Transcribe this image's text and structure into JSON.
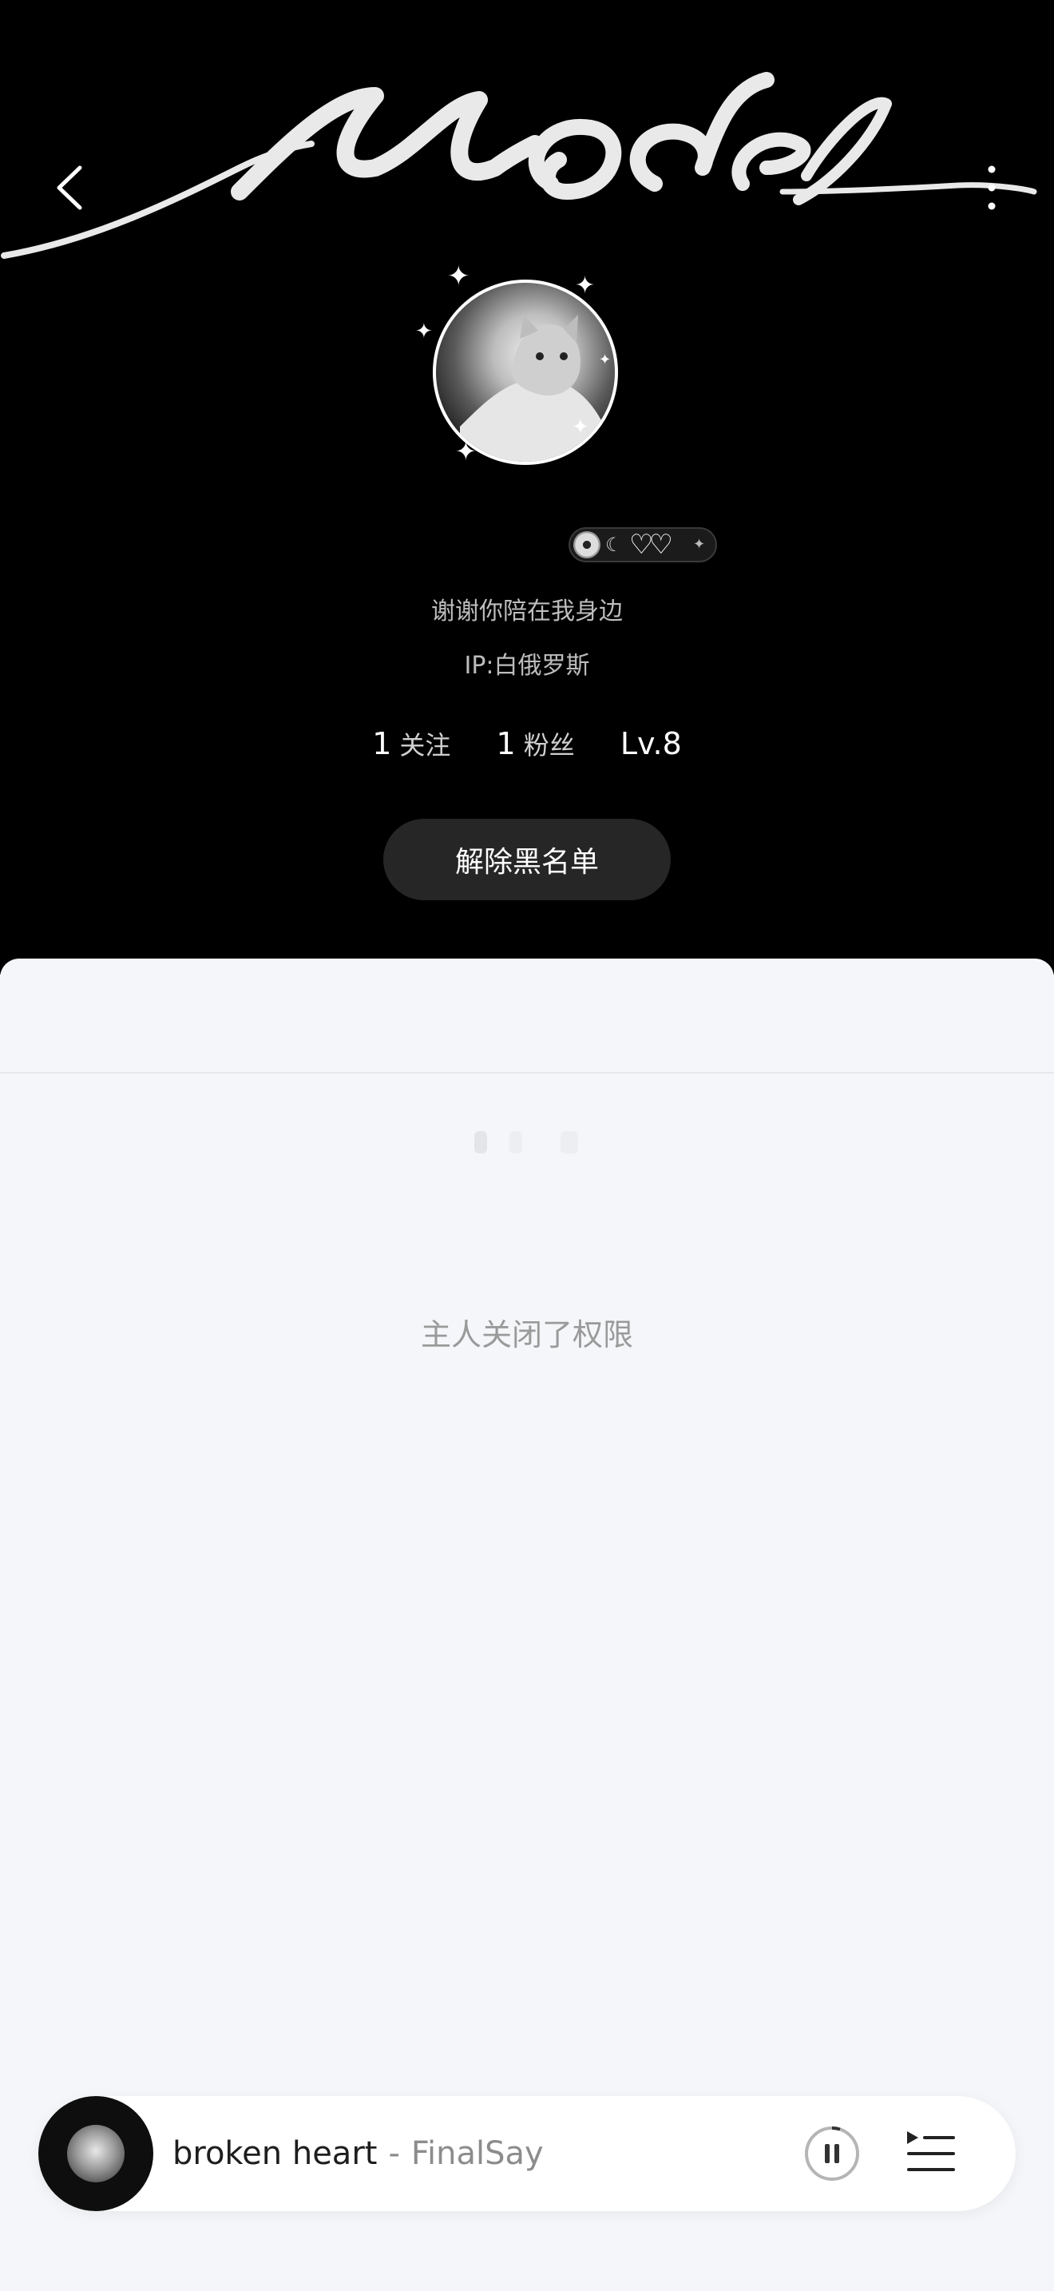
{
  "header": {
    "banner_text": "Model",
    "signature": "谢谢你陪在我身边",
    "ip": "IP:白俄罗斯",
    "stats": [
      {
        "count": "1",
        "label": "关注"
      },
      {
        "count": "1",
        "label": "粉丝"
      }
    ],
    "level": "Lv.8",
    "unblock_label": "解除黑名单"
  },
  "content": {
    "permission_message": "主人关闭了权限"
  },
  "player": {
    "title": "broken heart",
    "separator": "-",
    "artist": "FinalSay",
    "state": "playing"
  },
  "icons": {
    "back": "chevron-left-icon",
    "more": "more-vertical-icon",
    "pause": "pause-icon",
    "playlist": "playlist-icon"
  },
  "colors": {
    "header_bg": "#000000",
    "content_bg": "#f4f6f9",
    "button_bg": "#262626",
    "muted_text": "#9a9a9a"
  }
}
